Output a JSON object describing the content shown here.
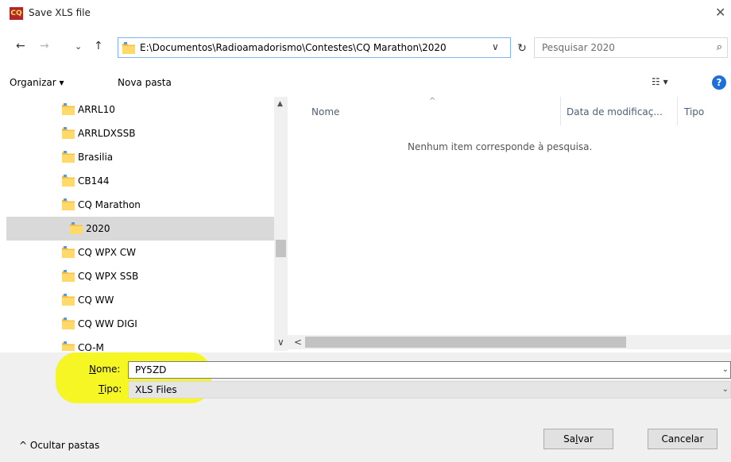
{
  "window": {
    "title": "Save XLS file",
    "app_icon_text": "CQ",
    "close_glyph": "✕"
  },
  "nav": {
    "back_glyph": "←",
    "forward_glyph": "→",
    "recent_glyph": "⌄",
    "up_glyph": "↑",
    "address": "E:\\Documentos\\Radioamadorismo\\Contestes\\CQ Marathon\\2020",
    "address_chevron": "∨",
    "refresh_glyph": "↻",
    "search_placeholder": "Pesquisar 2020",
    "search_icon_glyph": "⌕"
  },
  "toolbar": {
    "organize": "Organizar ▾",
    "new_folder": "Nova pasta",
    "view_glyph": "☷ ▾",
    "help_glyph": "?"
  },
  "tree": [
    {
      "label": "ARRL10",
      "selected": false,
      "indent": 1
    },
    {
      "label": "ARRLDXSSB",
      "selected": false,
      "indent": 1
    },
    {
      "label": "Brasilia",
      "selected": false,
      "indent": 1
    },
    {
      "label": "CB144",
      "selected": false,
      "indent": 1
    },
    {
      "label": "CQ Marathon",
      "selected": false,
      "indent": 1
    },
    {
      "label": "2020",
      "selected": true,
      "indent": 2
    },
    {
      "label": "CQ WPX CW",
      "selected": false,
      "indent": 1
    },
    {
      "label": "CQ WPX SSB",
      "selected": false,
      "indent": 1
    },
    {
      "label": "CQ WW",
      "selected": false,
      "indent": 1
    },
    {
      "label": "CQ WW DIGI",
      "selected": false,
      "indent": 1
    },
    {
      "label": "CQ-M",
      "selected": false,
      "indent": 1
    }
  ],
  "columns": {
    "name": "Nome",
    "date": "Data de modificaç...",
    "type": "Tipo",
    "sort_glyph": "^"
  },
  "empty_message": "Nenhum item corresponde à pesquisa.",
  "fields": {
    "name_label_u": "N",
    "name_label_rest": "ome:",
    "name_value": "PY5ZD",
    "type_label_u": "T",
    "type_label_rest": "ipo:",
    "type_value": "XLS Files",
    "chevron": "⌄"
  },
  "footer": {
    "hide_folders": "^  Ocultar pastas",
    "save_u_pre": "Sa",
    "save_u": "l",
    "save_post": "var",
    "cancel": "Cancelar"
  },
  "colors": {
    "highlight": "#f7f700",
    "address_border": "#7eb4ea",
    "selected_row": "#d9d9d9",
    "help_blue": "#1e6fd9",
    "column_header": "#4c607a"
  }
}
